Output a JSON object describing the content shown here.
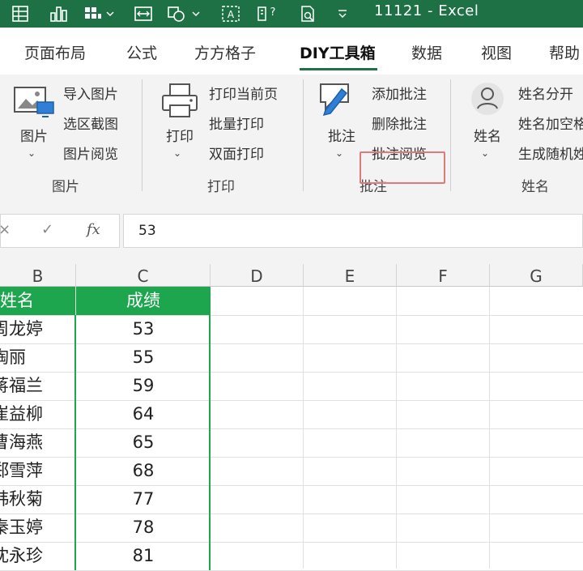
{
  "window": {
    "title": "11121  -  Excel"
  },
  "quick_access": [
    {
      "name": "table-icon"
    },
    {
      "name": "chart-icon"
    },
    {
      "name": "grid-dropdown-icon"
    },
    {
      "name": "screen-fit-icon"
    },
    {
      "name": "shapes-icon"
    },
    {
      "name": "textbox-icon"
    },
    {
      "name": "help-doc-icon"
    },
    {
      "name": "print-preview-icon"
    },
    {
      "name": "customize-icon"
    }
  ],
  "tabs": [
    {
      "label": "页面布局"
    },
    {
      "label": "公式"
    },
    {
      "label": "方方格子"
    },
    {
      "label": "DIY工具箱",
      "active": true
    },
    {
      "label": "数据"
    },
    {
      "label": "视图"
    },
    {
      "label": "帮助"
    }
  ],
  "ribbon": {
    "picture": {
      "big_label": "图片",
      "items": [
        "导入图片",
        "选区截图",
        "图片阅览"
      ],
      "group_label": "图片"
    },
    "print": {
      "big_label": "打印",
      "items": [
        "打印当前页",
        "批量打印",
        "双面打印"
      ],
      "group_label": "打印"
    },
    "comment": {
      "big_label": "批注",
      "items": [
        "添加批注",
        "删除批注",
        "批注阅览"
      ],
      "group_label": "批注"
    },
    "name": {
      "big_label": "姓名",
      "items": [
        "姓名分开",
        "姓名加空格",
        "生成随机姓"
      ],
      "group_label": "姓名"
    }
  },
  "formula_bar": {
    "cancel": "×",
    "confirm": "✓",
    "fx": "fx",
    "value": "53"
  },
  "columns": [
    "B",
    "C",
    "D",
    "E",
    "F",
    "G"
  ],
  "table": {
    "headers": [
      "姓名",
      "成绩"
    ],
    "rows": [
      [
        "周龙婷",
        "53"
      ],
      [
        "陶丽",
        "55"
      ],
      [
        "蒋福兰",
        "59"
      ],
      [
        "崔益柳",
        "64"
      ],
      [
        "曹海燕",
        "65"
      ],
      [
        "郑雪萍",
        "68"
      ],
      [
        "韩秋菊",
        "77"
      ],
      [
        "秦玉婷",
        "78"
      ],
      [
        "沈永珍",
        "81"
      ]
    ]
  },
  "colors": {
    "brand": "#1e7145",
    "header_fill": "#1ea64e",
    "highlight": "#e07a7a"
  }
}
